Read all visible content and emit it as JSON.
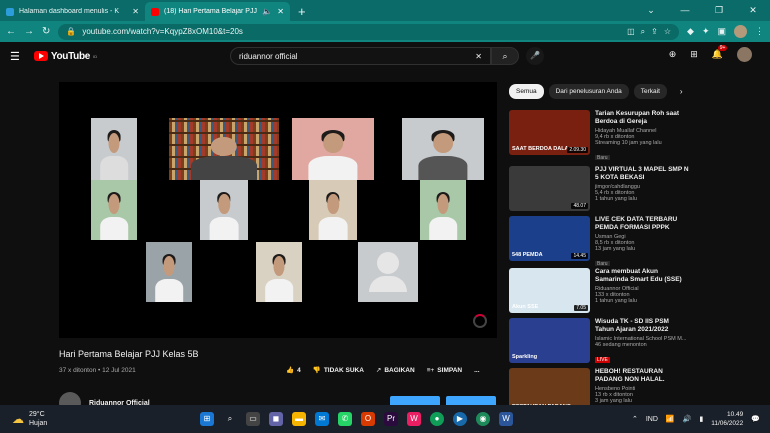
{
  "browser": {
    "tabs": [
      {
        "title": "Halaman dashboard menulis - K",
        "active": false
      },
      {
        "title": "(18) Hari Pertama Belajar PJJ",
        "active": true
      }
    ],
    "new_tab": "+",
    "address": "youtube.com/watch?v=KqypZ8xOM10&t=20s"
  },
  "youtube": {
    "logo_text": "YouTube",
    "logo_country": "ID",
    "search_query": "riduannor official",
    "notification_count": "9+"
  },
  "video": {
    "title": "Hari Pertama Belajar PJJ Kelas 5B",
    "views": "37 x ditonton",
    "date": "12 Jul 2021",
    "likes": "4",
    "dislike_label": "TIDAK SUKA",
    "share_label": "BAGIKAN",
    "save_label": "SIMPAN",
    "more_label": "...",
    "channel": "Riduannor Official"
  },
  "chips": [
    "Semua",
    "Dari penelusuran Anda",
    "Terkait"
  ],
  "recommendations": [
    {
      "title": "Tarian Kesurupan Roh saat Berdoa di Gereja",
      "channel": "Hidayah Muallaf Channel",
      "stats": "9,4 rb x ditonton",
      "extra": "Streaming 10 jam yang lalu",
      "badge": "Baru",
      "duration": "2.09.30",
      "thumb_text": "SAAT BERDOA DALA",
      "color": "#7a2010"
    },
    {
      "title": "PJJ VIRTUAL 3 MAPEL SMP N 5 KOTA BEKASI",
      "channel": "jimgor/cahdlanggu",
      "stats": "5,4 rb x ditonton",
      "extra": "1 tahun yang lalu",
      "badge": "",
      "duration": "48.07",
      "thumb_text": "",
      "color": "#3a3a3a"
    },
    {
      "title": "LIVE CEK DATA TERBARU PEMDA FORMASI PPPK 2022...",
      "channel": "Usman Gegi",
      "stats": "8,5 rb x ditonton",
      "extra": "13 jam yang lalu",
      "badge": "Baru",
      "duration": "14.45",
      "thumb_text": "548 PEMDA",
      "color": "#1b3f8a"
    },
    {
      "title": "Cara membuat Akun Samarinda Smart Edu (SSE)",
      "channel": "Riduannor Official",
      "stats": "133 x ditonton",
      "extra": "1 tahun yang lalu",
      "badge": "",
      "duration": "7.05",
      "thumb_text": "Akun SSE",
      "color": "#d8e6ef"
    },
    {
      "title": "Wisuda TK - SD IIS PSM Tahun Ajaran 2021/2022 (Sparkling...",
      "channel": "Islamic International School PSM M...",
      "stats": "46 sedang menonton",
      "extra": "",
      "badge": "LIVE",
      "duration": "",
      "thumb_text": "Sparkling",
      "color": "#2a3f8f"
    },
    {
      "title": "HEBOH! RESTAURAN PADANG NON HALAL. MENUNYA BABI...",
      "channel": "Hensbeno Pointi",
      "stats": "13 rb x ditonton",
      "extra": "3 jam yang lalu",
      "badge": "",
      "duration": "",
      "thumb_text": "RESTAURAN PADANG",
      "color": "#6b3a18"
    }
  ],
  "taskbar": {
    "temperature": "29°C",
    "weather": "Hujan",
    "language": "IND",
    "time": "10.49",
    "date": "11/06/2022"
  }
}
